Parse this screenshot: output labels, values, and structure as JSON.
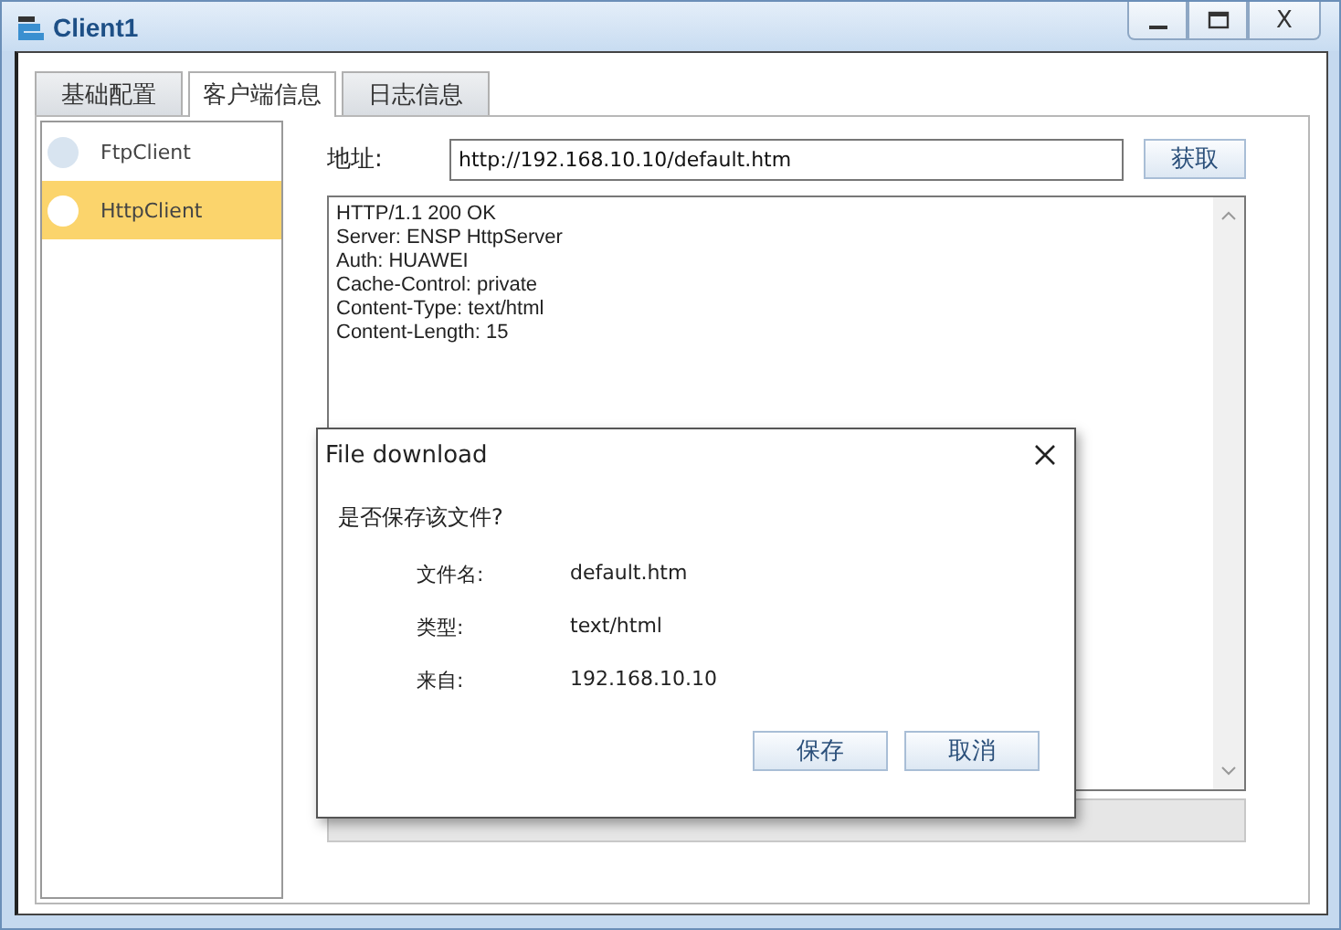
{
  "window": {
    "title": "Client1",
    "close_label": "X"
  },
  "tabs": [
    {
      "label": "基础配置",
      "selected": false
    },
    {
      "label": "客户端信息",
      "selected": true
    },
    {
      "label": "日志信息",
      "selected": false
    }
  ],
  "sidebar": {
    "items": [
      {
        "label": "FtpClient",
        "selected": false
      },
      {
        "label": "HttpClient",
        "selected": true
      }
    ]
  },
  "address": {
    "label": "地址:",
    "value": "http://192.168.10.10/default.htm",
    "button": "获取"
  },
  "response": [
    "HTTP/1.1 200 OK",
    "Server: ENSP HttpServer",
    "Auth: HUAWEI",
    "Cache-Control: private",
    "Content-Type: text/html",
    "Content-Length: 15"
  ],
  "dialog": {
    "title": "File download",
    "question": "是否保存该文件?",
    "fields": [
      {
        "label": "文件名:",
        "value": "default.htm"
      },
      {
        "label": "类型:",
        "value": "text/html"
      },
      {
        "label": "来自:",
        "value": "192.168.10.10"
      }
    ],
    "buttons": [
      "保存",
      "取消"
    ]
  }
}
